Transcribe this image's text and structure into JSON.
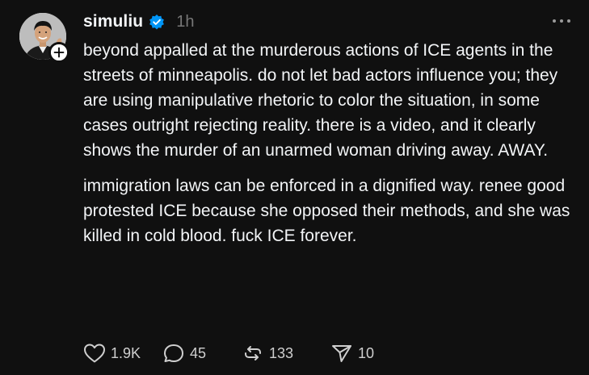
{
  "post": {
    "author": {
      "username": "simuliu",
      "verified": true,
      "avatar_icon": "profile-photo",
      "follow_badge_icon": "plus-icon"
    },
    "timestamp": "1h",
    "more_icon": "ellipsis-icon",
    "paragraphs": [
      "beyond appalled at the murderous actions of ICE agents in the streets of minneapolis. do not let bad actors influence you; they are using manipulative rhetoric to color the situation, in some cases outright rejecting reality. there is a video, and it clearly shows the murder of an unarmed woman driving away. AWAY.",
      "immigration laws can be enforced in a dignified way. renee good protested ICE because she opposed their methods, and she was killed in cold blood. fuck ICE forever."
    ],
    "actions": {
      "likes": "1.9K",
      "replies": "45",
      "reposts": "133",
      "shares": "10"
    }
  },
  "colors": {
    "background": "#101010",
    "text": "#f3f5f7",
    "muted": "#777777",
    "verified_blue": "#0095f6"
  }
}
